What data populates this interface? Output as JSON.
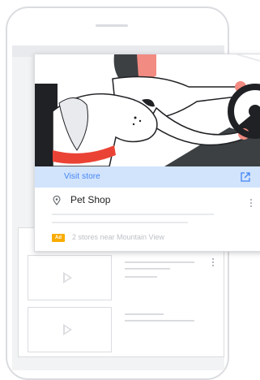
{
  "ad": {
    "visit_label": "Visit store",
    "title": "Pet Shop",
    "badge": "Ad",
    "stores_text": "2 stores near Mountain View"
  },
  "colors": {
    "accent_blue": "#4285f4",
    "visit_bar_bg": "#d2e3fc",
    "badge_yellow": "#f9ab00",
    "phone_outline": "#dadce0"
  },
  "icons": [
    "external-link-icon",
    "location-pin-icon",
    "more-vert-icon",
    "play-icon"
  ]
}
